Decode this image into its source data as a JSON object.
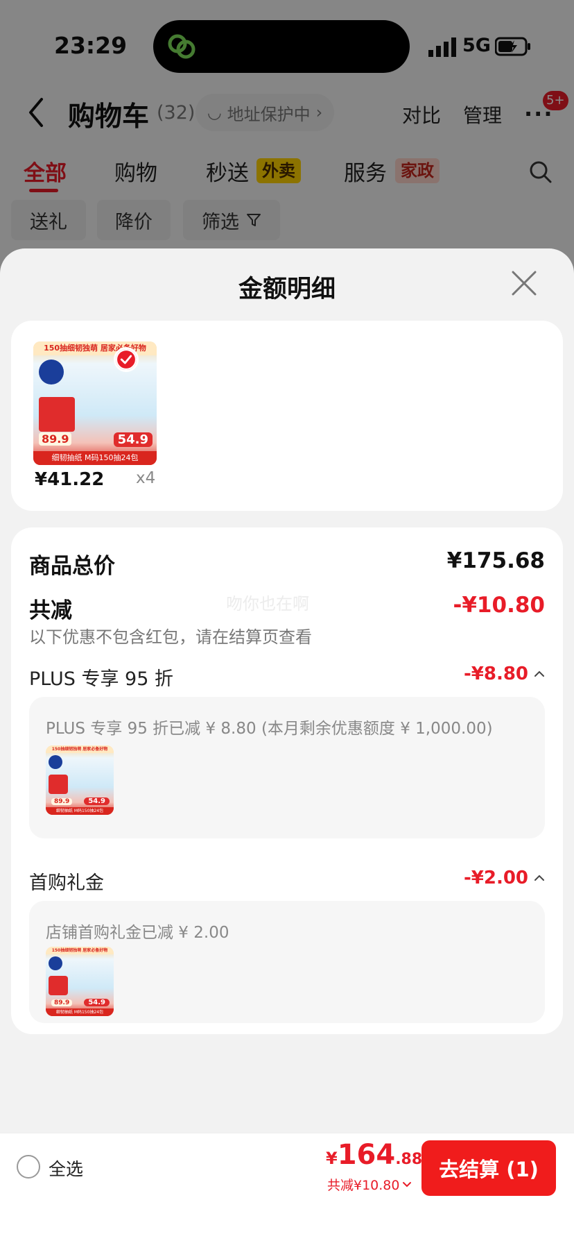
{
  "status_bar": {
    "time": "23:29",
    "network": "5G"
  },
  "nav": {
    "title": "购物车",
    "count": "(32)",
    "address_protection": "地址保护中",
    "compare": "对比",
    "manage": "管理",
    "more_badge": "5+"
  },
  "tabs": [
    {
      "label": "全部",
      "active": true
    },
    {
      "label": "购物"
    },
    {
      "label": "秒送",
      "tag": "外卖"
    },
    {
      "label": "服务",
      "tag": "家政"
    }
  ],
  "chips": [
    "送礼",
    "降价",
    "筛选"
  ],
  "sheet": {
    "title": "金额明细",
    "product": {
      "image_band_text": "150抽细韧独萌 居家必备好物",
      "image_bottom_text": "细韧抽纸 M码150抽24包",
      "image_price_left": "89.9",
      "image_price_right": "54.9",
      "price": "¥41.22",
      "qty": "x4"
    },
    "goods_total_label": "商品总价",
    "goods_total_value": "¥175.68",
    "total_discount_label": "共减",
    "total_discount_value": "-¥10.80",
    "discount_note": "以下优惠不包含红包，请在结算页查看",
    "watermark": "吻你也在啊",
    "plus": {
      "label": "PLUS 专享 95 折",
      "value": "-¥8.80",
      "detail": "PLUS 专享 95 折已减 ¥ 8.80 (本月剩余优惠额度 ¥ 1,000.00)"
    },
    "first_gift": {
      "label": "首购礼金",
      "value": "-¥2.00",
      "detail": "店铺首购礼金已减 ¥ 2.00"
    }
  },
  "bottom_bar": {
    "select_all": "全选",
    "currency": "¥",
    "total_int": "164",
    "total_dec": ".88",
    "saved": "共减¥10.80",
    "checkout": "去结算 (1)"
  },
  "colors": {
    "accent": "#e81c28",
    "checkout": "#f01c1c"
  }
}
